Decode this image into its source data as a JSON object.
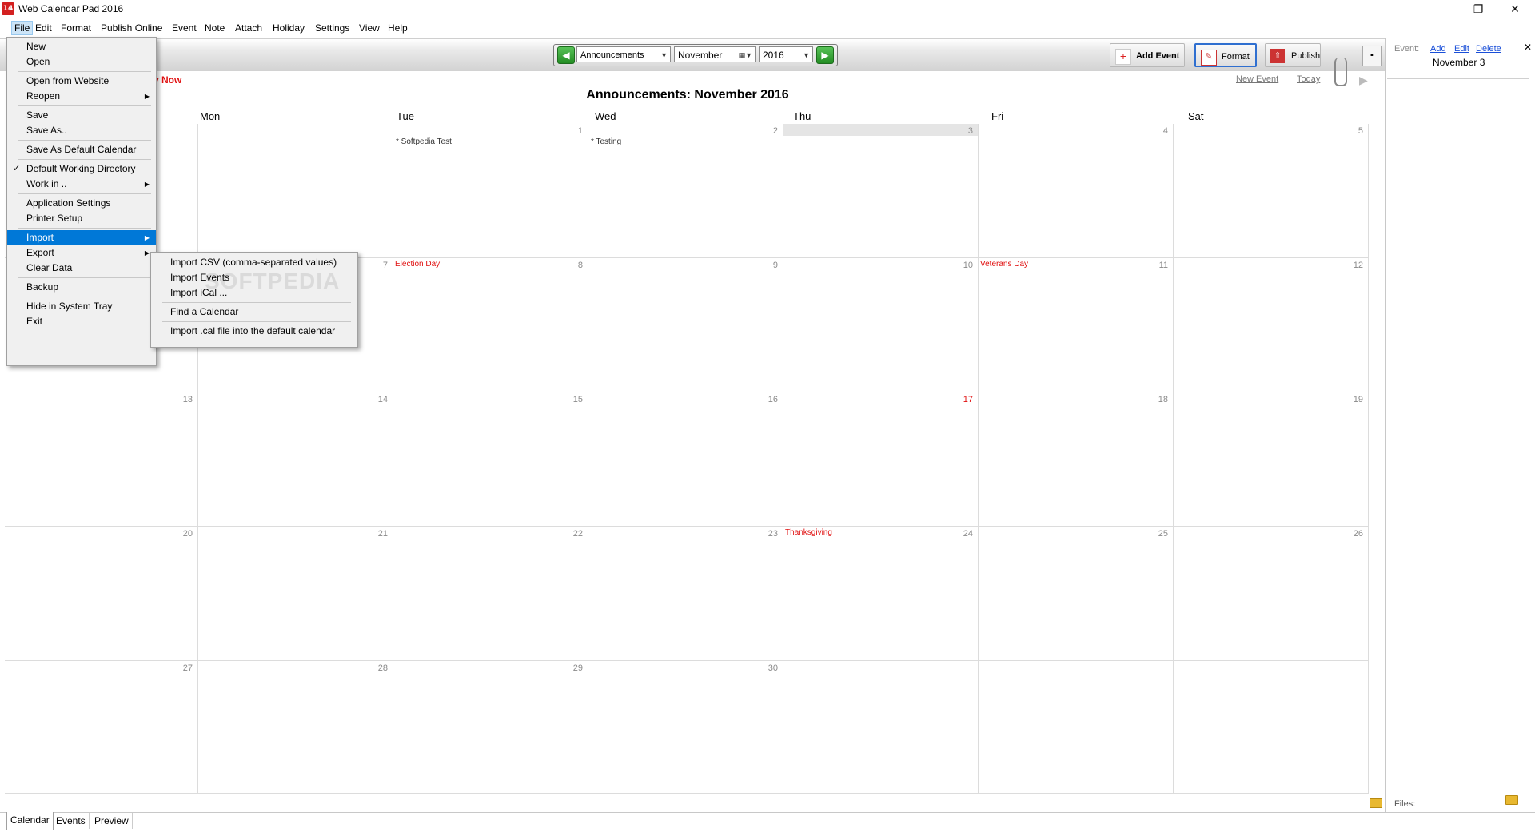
{
  "app": {
    "title": "Web Calendar Pad 2016",
    "icon_text": "14"
  },
  "window_controls": {
    "minimize": "—",
    "maximize": "❐",
    "close": "✕"
  },
  "menu": [
    "File",
    "Edit",
    "Format",
    "Publish Online",
    "Event",
    "Note",
    "Attach",
    "Holiday",
    "Settings",
    "View",
    "Help"
  ],
  "toolbar": {
    "calendar_select": "Announcements",
    "month_select": "November",
    "year_select": "2016",
    "add_event": "Add Event",
    "format": "Format",
    "publish": "Publish"
  },
  "buy_now": "y Now",
  "calendar_title": "Announcements:  November 2016",
  "links": {
    "new_event": "New Event",
    "today": "Today"
  },
  "day_headers": [
    "Mon",
    "Tue",
    "Wed",
    "Thu",
    "Fri",
    "Sat"
  ],
  "weeks": [
    [
      {
        "d": ""
      },
      {
        "d": ""
      },
      {
        "d": "1",
        "ev": "* Softpedia Test"
      },
      {
        "d": "2",
        "ev": "* Testing"
      },
      {
        "d": "3",
        "hl": true
      },
      {
        "d": "4"
      },
      {
        "d": "5"
      }
    ],
    [
      {
        "d": ""
      },
      {
        "d": "7"
      },
      {
        "d": "8",
        "hol": "Election Day"
      },
      {
        "d": "9"
      },
      {
        "d": "10"
      },
      {
        "d": "11",
        "hol": "Veterans Day"
      },
      {
        "d": "12"
      }
    ],
    [
      {
        "d": "13"
      },
      {
        "d": "14"
      },
      {
        "d": "15"
      },
      {
        "d": "16"
      },
      {
        "d": "17",
        "today": true
      },
      {
        "d": "18"
      },
      {
        "d": "19"
      }
    ],
    [
      {
        "d": "20"
      },
      {
        "d": "21"
      },
      {
        "d": "22"
      },
      {
        "d": "23"
      },
      {
        "d": "24",
        "hol": "Thanksgiving"
      },
      {
        "d": "25"
      },
      {
        "d": "26"
      }
    ],
    [
      {
        "d": "27"
      },
      {
        "d": "28"
      },
      {
        "d": "29"
      },
      {
        "d": "30"
      },
      {
        "d": ""
      },
      {
        "d": ""
      },
      {
        "d": ""
      }
    ]
  ],
  "file_menu": [
    {
      "label": "New"
    },
    {
      "label": "Open"
    },
    {
      "sep": true
    },
    {
      "label": "Open from Website"
    },
    {
      "label": "Reopen",
      "sub": true
    },
    {
      "sep": true
    },
    {
      "label": "Save"
    },
    {
      "label": "Save As.."
    },
    {
      "sep": true
    },
    {
      "label": "Save As Default Calendar"
    },
    {
      "sep": true
    },
    {
      "label": "Default Working Directory",
      "check": true
    },
    {
      "label": "Work in ..",
      "sub": true
    },
    {
      "sep": true
    },
    {
      "label": "Application Settings"
    },
    {
      "label": "Printer Setup"
    },
    {
      "sep": true
    },
    {
      "label": "Import",
      "sub": true,
      "hi": true
    },
    {
      "label": "Export",
      "sub": true
    },
    {
      "label": "Clear Data"
    },
    {
      "sep": true
    },
    {
      "label": "Backup"
    },
    {
      "sep": true
    },
    {
      "label": "Hide in System Tray"
    },
    {
      "label": "Exit"
    }
  ],
  "import_submenu": [
    {
      "label": "Import CSV (comma-separated values)"
    },
    {
      "label": "Import Events"
    },
    {
      "label": "Import iCal ..."
    },
    {
      "sep": true
    },
    {
      "label": "Find a Calendar"
    },
    {
      "sep": true
    },
    {
      "label": "Import .cal file into the default calendar"
    }
  ],
  "watermark": "SOFTPEDIA",
  "right_pane": {
    "event_label": "Event:",
    "add": "Add",
    "edit": "Edit",
    "delete": "Delete",
    "date": "November 3",
    "files_label": "Files:"
  },
  "bottom_tabs": [
    "Calendar",
    "Events",
    "Preview"
  ],
  "colors": {
    "accent": "#0078d7",
    "holiday": "#e01010",
    "link": "#1a4fd8"
  }
}
